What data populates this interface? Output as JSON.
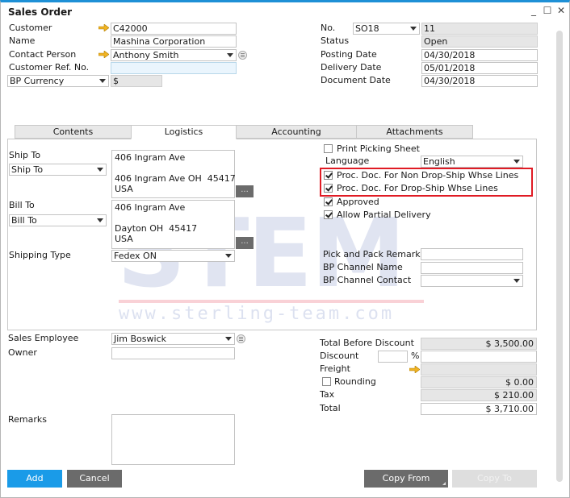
{
  "window": {
    "title": "Sales Order",
    "controls": {
      "minimize": "_",
      "maximize": "☐",
      "close": "✕"
    }
  },
  "header_left": {
    "customer": {
      "label": "Customer",
      "value": "C42000",
      "icon": "link-arrow-icon"
    },
    "name": {
      "label": "Name",
      "value": "Mashina Corporation"
    },
    "contact_person": {
      "label": "Contact Person",
      "value": "Anthony Smith",
      "icon": "link-arrow-icon"
    },
    "customer_ref_no": {
      "label": "Customer Ref. No.",
      "value": ""
    },
    "currency": {
      "selected": "BP Currency",
      "value": "$"
    }
  },
  "header_right": {
    "no": {
      "label": "No.",
      "series": "SO18",
      "value": "11"
    },
    "status": {
      "label": "Status",
      "value": "Open"
    },
    "posting_date": {
      "label": "Posting Date",
      "value": "04/30/2018"
    },
    "delivery_date": {
      "label": "Delivery Date",
      "value": "05/01/2018"
    },
    "document_date": {
      "label": "Document Date",
      "value": "04/30/2018"
    }
  },
  "tabs": [
    {
      "label": "Contents",
      "active": false
    },
    {
      "label": "Logistics",
      "active": true
    },
    {
      "label": "Accounting",
      "active": false
    },
    {
      "label": "Attachments",
      "active": false
    }
  ],
  "logistics": {
    "ship_to": {
      "label": "Ship To",
      "selected": "Ship To",
      "address": "406 Ingram Ave\n\n406 Ingram Ave OH  45417\nUSA",
      "ellipsis": "..."
    },
    "bill_to": {
      "label": "Bill To",
      "selected": "Bill To",
      "address": "406 Ingram Ave\n\nDayton OH  45417\nUSA",
      "ellipsis": "..."
    },
    "shipping_type": {
      "label": "Shipping Type",
      "value": "Fedex ON"
    },
    "print_picking_sheet": {
      "label": "Print Picking Sheet",
      "checked": false
    },
    "language": {
      "label": "Language",
      "value": "English"
    },
    "proc_doc_non_drop_ship": {
      "label": "Proc. Doc. For Non Drop-Ship Whse Lines",
      "checked": true
    },
    "proc_doc_drop_ship": {
      "label": "Proc. Doc. For Drop-Ship Whse Lines",
      "checked": true
    },
    "approved": {
      "label": "Approved",
      "checked": true
    },
    "allow_partial_delivery": {
      "label": "Allow Partial Delivery",
      "checked": true
    },
    "pick_pack_remarks": {
      "label": "Pick and Pack Remarks",
      "value": ""
    },
    "bp_channel_name": {
      "label": "BP Channel Name",
      "value": ""
    },
    "bp_channel_contact": {
      "label": "BP Channel Contact",
      "value": ""
    }
  },
  "footer_left": {
    "sales_employee": {
      "label": "Sales Employee",
      "value": "Jim Boswick"
    },
    "owner": {
      "label": "Owner",
      "value": ""
    },
    "remarks": {
      "label": "Remarks",
      "value": ""
    }
  },
  "totals": {
    "total_before_discount": {
      "label": "Total Before Discount",
      "value": "$ 3,500.00"
    },
    "discount": {
      "label": "Discount",
      "percent": "",
      "percent_sign": "%",
      "value": ""
    },
    "freight": {
      "label": "Freight",
      "value": ""
    },
    "rounding": {
      "label": "Rounding",
      "checked": false,
      "value": "$ 0.00"
    },
    "tax": {
      "label": "Tax",
      "value": "$ 210.00"
    },
    "total": {
      "label": "Total",
      "value": "$ 3,710.00"
    }
  },
  "buttons": {
    "add": "Add",
    "cancel": "Cancel",
    "copy_from": "Copy From",
    "copy_to": "Copy To"
  },
  "watermark": {
    "logo": "STEM",
    "url": "www.sterling-team.com",
    "registered": "®"
  },
  "colors": {
    "accent": "#1e90d6",
    "add_button": "#1a9be8",
    "dark_button": "#6b6b6b",
    "disabled_button": "#dedede",
    "highlight": "#e01b24",
    "link_arrow": "#f0b323"
  }
}
